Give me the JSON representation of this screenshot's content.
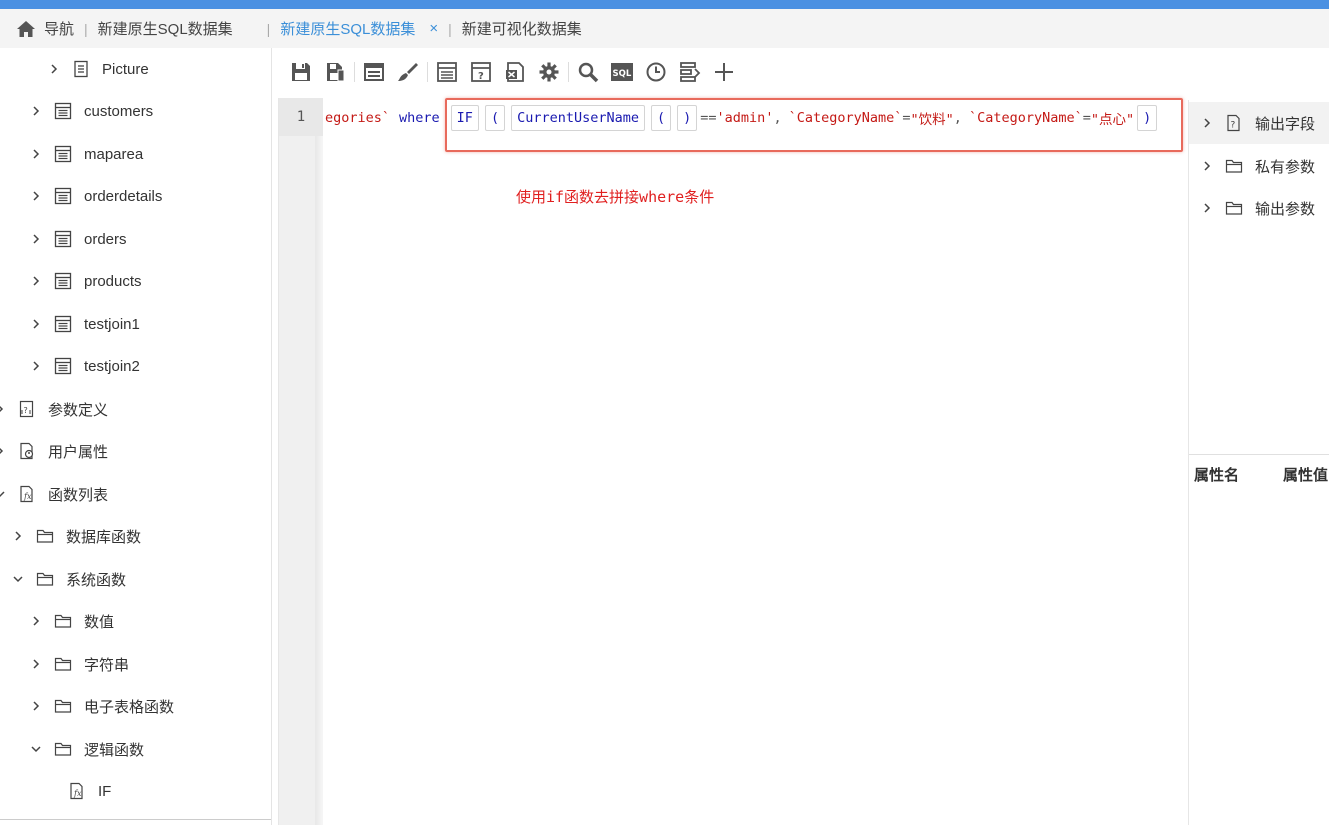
{
  "tabs": {
    "home_label": "导航",
    "items": [
      {
        "label": "新建原生SQL数据集"
      },
      {
        "label": "新建原生SQL数据集"
      },
      {
        "label": "新建可视化数据集"
      }
    ],
    "close_glyph": "×"
  },
  "sidebar": {
    "items": [
      {
        "label": "Picture",
        "icon": "table-icon"
      },
      {
        "label": "customers",
        "icon": "table-icon"
      },
      {
        "label": "maparea",
        "icon": "table-icon"
      },
      {
        "label": "orderdetails",
        "icon": "table-icon"
      },
      {
        "label": "orders",
        "icon": "table-icon"
      },
      {
        "label": "products",
        "icon": "table-icon"
      },
      {
        "label": "testjoin1",
        "icon": "table-icon"
      },
      {
        "label": "testjoin2",
        "icon": "table-icon"
      },
      {
        "label": "参数定义",
        "icon": "param-icon"
      },
      {
        "label": "用户属性",
        "icon": "user-attr-icon"
      },
      {
        "label": "函数列表",
        "icon": "function-icon"
      },
      {
        "label": "数据库函数",
        "icon": "folder-icon"
      },
      {
        "label": "系统函数",
        "icon": "folder-icon"
      },
      {
        "label": "数值",
        "icon": "folder-icon"
      },
      {
        "label": "字符串",
        "icon": "folder-icon"
      },
      {
        "label": "电子表格函数",
        "icon": "folder-icon"
      },
      {
        "label": "逻辑函数",
        "icon": "folder-icon"
      },
      {
        "label": "IF",
        "icon": "function-icon"
      }
    ]
  },
  "toolbar": {
    "icons": [
      "save-icon",
      "save-as-icon",
      "layout-icon",
      "brush-icon",
      "table-view-icon",
      "param-view-icon",
      "export-icon",
      "settings-icon",
      "search-icon",
      "sql-icon",
      "clock-icon",
      "filter-icon",
      "add-icon"
    ],
    "sql_text": "SQL"
  },
  "editor": {
    "line_number": "1",
    "code": {
      "prefix": "egories`",
      "where": "where",
      "if": "IF",
      "lparen": "(",
      "fn": "CurrentUserName",
      "inner_lparen": "(",
      "inner_rparen": ")",
      "eq": "==",
      "admin": "'admin'",
      "comma1": ",",
      "field1": "`CategoryName`",
      "assign1": "=",
      "val1": "\"饮料\"",
      "comma2": ",",
      "field2": "`CategoryName`",
      "assign2": "=",
      "val2": "\"点心\"",
      "rparen": ")"
    },
    "annotation": "使用if函数去拼接where条件",
    "highlight_color": "#e86a5c"
  },
  "right_panel": {
    "items": [
      {
        "label": "输出字段",
        "icon": "output-field-icon"
      },
      {
        "label": "私有参数",
        "icon": "folder-icon"
      },
      {
        "label": "输出参数",
        "icon": "folder-icon"
      }
    ],
    "prop_name": "属性名",
    "prop_value": "属性值"
  },
  "colors": {
    "accent": "#4a90e2",
    "active_tab": "#3b8fd8",
    "string": "#c41a16",
    "keyword": "#1a1ab0"
  }
}
